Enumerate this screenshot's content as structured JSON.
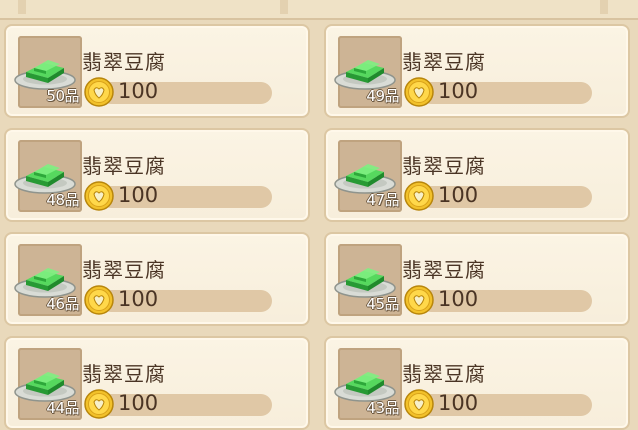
{
  "items": [
    {
      "name": "翡翠豆腐",
      "grade": "50品",
      "price": "100"
    },
    {
      "name": "翡翠豆腐",
      "grade": "49品",
      "price": "100"
    },
    {
      "name": "翡翠豆腐",
      "grade": "48品",
      "price": "100"
    },
    {
      "name": "翡翠豆腐",
      "grade": "47品",
      "price": "100"
    },
    {
      "name": "翡翠豆腐",
      "grade": "46品",
      "price": "100"
    },
    {
      "name": "翡翠豆腐",
      "grade": "45品",
      "price": "100"
    },
    {
      "name": "翡翠豆腐",
      "grade": "44品",
      "price": "100"
    },
    {
      "name": "翡翠豆腐",
      "grade": "43品",
      "price": "100"
    }
  ],
  "icons": {
    "dish": "jade-tofu-dish-icon",
    "currency": "gold-coin-icon"
  },
  "colors": {
    "card_bg": "#f9f1df",
    "bar_bg": "#e0c8a6",
    "text": "#4a3424",
    "tofu": "#3dc44a",
    "coin": "#f2c12a"
  }
}
